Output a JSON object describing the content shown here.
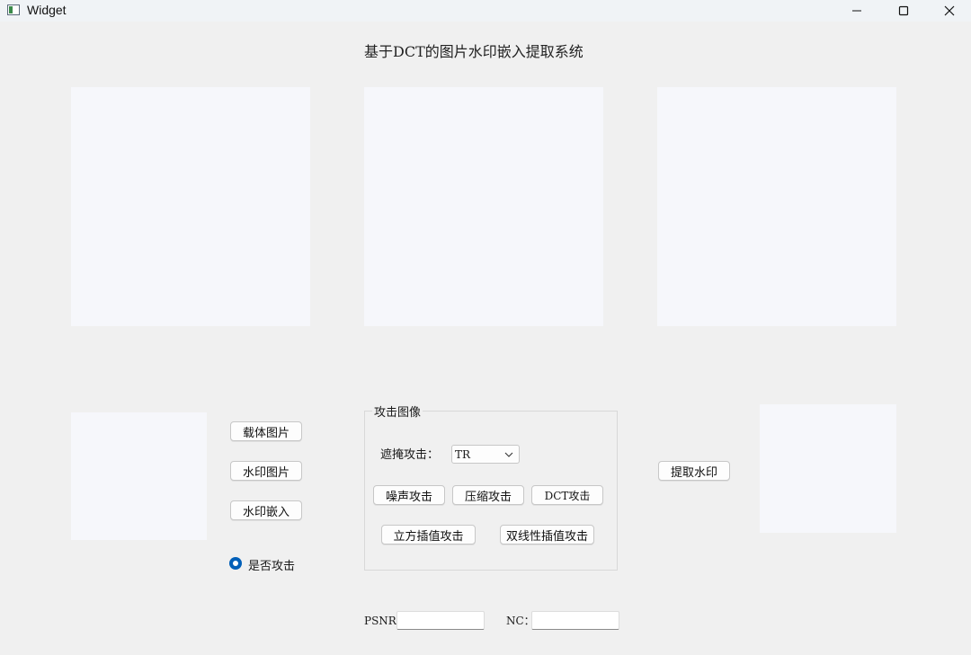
{
  "window": {
    "title": "Widget"
  },
  "header": {
    "title": "基于DCT的图片水印嵌入提取系统"
  },
  "buttons": {
    "carrier_image": "载体图片",
    "watermark_image": "水印图片",
    "embed_watermark": "水印嵌入",
    "extract_watermark": "提取水印"
  },
  "attack_group": {
    "title": "攻击图像",
    "mask_label": "遮掩攻击：",
    "mask_selected": "TR",
    "noise": "噪声攻击",
    "compress": "压缩攻击",
    "dct": "DCT攻击",
    "cubic": "立方插值攻击",
    "bilinear": "双线性插值攻击"
  },
  "attack_toggle": {
    "label": "是否攻击",
    "checked": true
  },
  "metrics": {
    "psnr_label": "PSNR：",
    "psnr_value": "",
    "nc_label": "NC：",
    "nc_value": ""
  },
  "colors": {
    "accent": "#005fb8",
    "panel": "#f6f7fb",
    "background": "#f0f0f0"
  }
}
